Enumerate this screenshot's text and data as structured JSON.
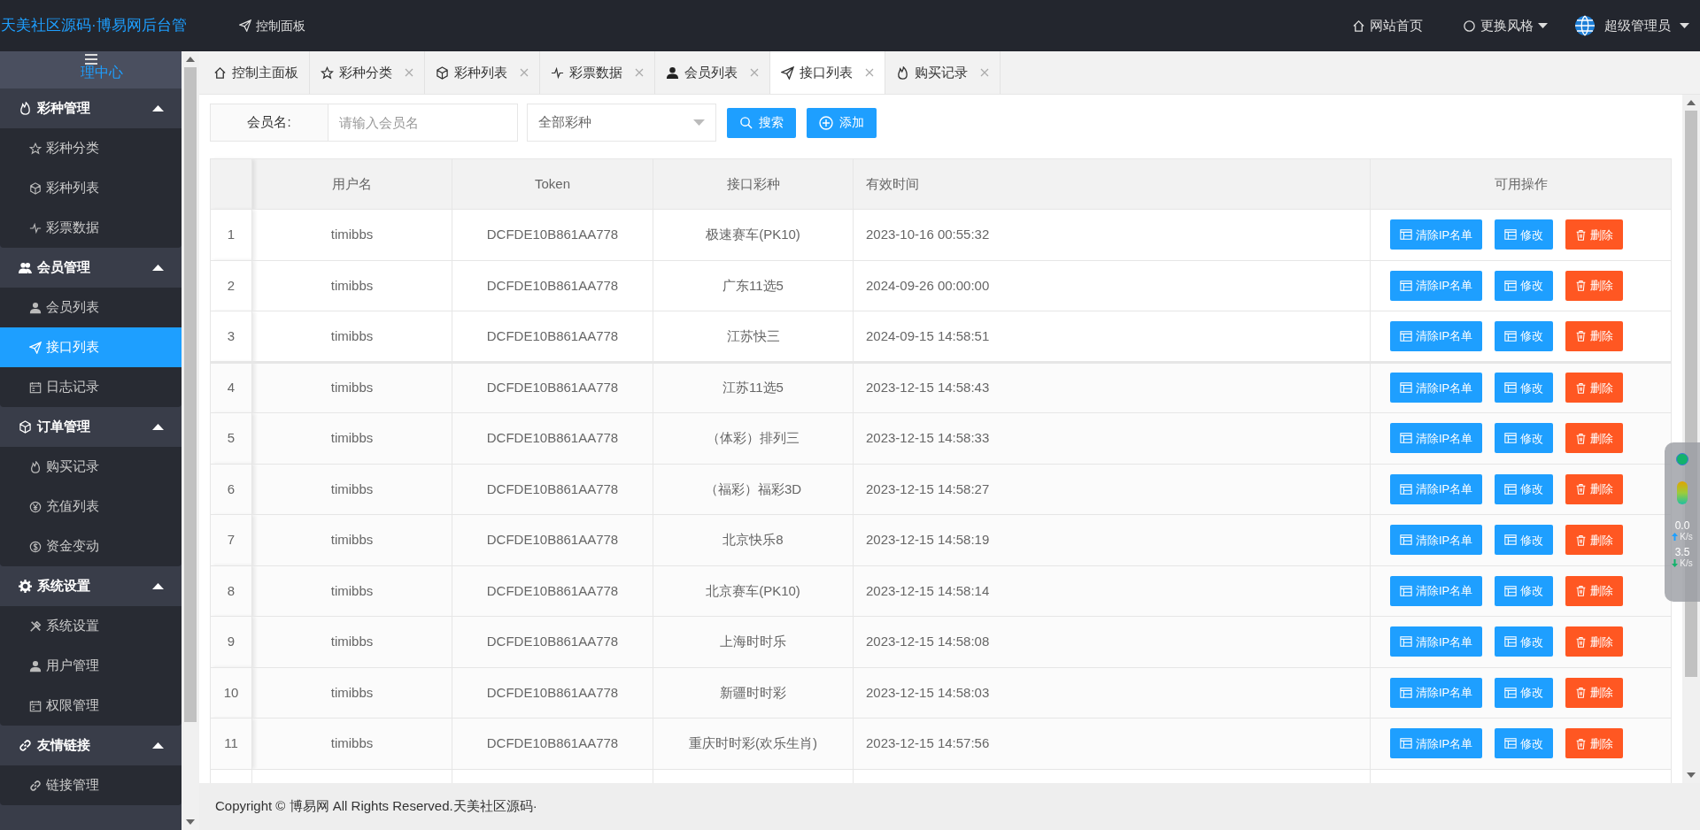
{
  "header": {
    "logo": "天美社区源码·博易网后台管",
    "nav_link": "控制面板",
    "right_links": [
      {
        "kind": "home",
        "label": "网站首页"
      },
      {
        "kind": "theme",
        "label": "更换风格"
      }
    ],
    "user": "超级管理员"
  },
  "sidebar": {
    "title": "理中心",
    "groups": [
      {
        "label": "彩种管理",
        "expanded": true,
        "items": [
          {
            "label": "彩种分类",
            "selected": false
          },
          {
            "label": "彩种列表",
            "selected": false
          },
          {
            "label": "彩票数据",
            "selected": false
          }
        ]
      },
      {
        "label": "会员管理",
        "expanded": true,
        "items": [
          {
            "label": "会员列表",
            "selected": false
          },
          {
            "label": "接口列表",
            "selected": true
          },
          {
            "label": "日志记录",
            "selected": false
          }
        ]
      },
      {
        "label": "订单管理",
        "expanded": true,
        "items": [
          {
            "label": "购买记录",
            "selected": false
          },
          {
            "label": "充值列表",
            "selected": false
          },
          {
            "label": "资金变动",
            "selected": false
          }
        ]
      },
      {
        "label": "系统设置",
        "expanded": true,
        "items": [
          {
            "label": "系统设置",
            "selected": false
          },
          {
            "label": "用户管理",
            "selected": false
          },
          {
            "label": "权限管理",
            "selected": false
          }
        ]
      },
      {
        "label": "友情链接",
        "expanded": true,
        "items": [
          {
            "label": "链接管理",
            "selected": false
          }
        ]
      }
    ]
  },
  "tabs": [
    {
      "label": "控制主面板",
      "closable": false,
      "selected": false
    },
    {
      "label": "彩种分类",
      "closable": true,
      "selected": false
    },
    {
      "label": "彩种列表",
      "closable": true,
      "selected": false
    },
    {
      "label": "彩票数据",
      "closable": true,
      "selected": false
    },
    {
      "label": "会员列表",
      "closable": true,
      "selected": false
    },
    {
      "label": "接口列表",
      "closable": true,
      "selected": true
    },
    {
      "label": "购买记录",
      "closable": true,
      "selected": false
    }
  ],
  "filter": {
    "label": "会员名:",
    "placeholder": "请输入会员名",
    "select": "全部彩种",
    "buttons": [
      {
        "kind": "search",
        "label": "搜索"
      },
      {
        "kind": "add",
        "label": "添加"
      }
    ]
  },
  "table": {
    "columns": [
      "用户名",
      "Token",
      "接口彩种",
      "有效时间",
      "可用操作"
    ],
    "rows": [
      {
        "index": "1",
        "username": "timibbs",
        "token": "DCFDE10B861AA778",
        "lottery": "极速赛车(PK10)",
        "expires": "2023-10-16 00:55:32",
        "actions": [
          {
            "kind": "clear",
            "label": "清除IP名单"
          },
          {
            "kind": "edit",
            "label": "修改"
          },
          {
            "kind": "delete",
            "label": "删除"
          }
        ]
      },
      {
        "index": "2",
        "username": "timibbs",
        "token": "DCFDE10B861AA778",
        "lottery": "广东11选5",
        "expires": "2024-09-26 00:00:00",
        "actions": [
          {
            "kind": "clear",
            "label": "清除IP名单"
          },
          {
            "kind": "edit",
            "label": "修改"
          },
          {
            "kind": "delete",
            "label": "删除"
          }
        ]
      },
      {
        "index": "3",
        "username": "timibbs",
        "token": "DCFDE10B861AA778",
        "lottery": "江苏快三",
        "expires": "2024-09-15 14:58:51",
        "actions": [
          {
            "kind": "clear",
            "label": "清除IP名单"
          },
          {
            "kind": "edit",
            "label": "修改"
          },
          {
            "kind": "delete",
            "label": "删除"
          }
        ]
      },
      {
        "index": "4",
        "username": "timibbs",
        "token": "DCFDE10B861AA778",
        "lottery": "江苏11选5",
        "expires": "2023-12-15 14:58:43",
        "actions": [
          {
            "kind": "clear",
            "label": "清除IP名单"
          },
          {
            "kind": "edit",
            "label": "修改"
          },
          {
            "kind": "delete",
            "label": "删除"
          }
        ]
      },
      {
        "index": "5",
        "username": "timibbs",
        "token": "DCFDE10B861AA778",
        "lottery": "（体彩）排列三",
        "expires": "2023-12-15 14:58:33",
        "actions": [
          {
            "kind": "clear",
            "label": "清除IP名单"
          },
          {
            "kind": "edit",
            "label": "修改"
          },
          {
            "kind": "delete",
            "label": "删除"
          }
        ]
      },
      {
        "index": "6",
        "username": "timibbs",
        "token": "DCFDE10B861AA778",
        "lottery": "（福彩）福彩3D",
        "expires": "2023-12-15 14:58:27",
        "actions": [
          {
            "kind": "clear",
            "label": "清除IP名单"
          },
          {
            "kind": "edit",
            "label": "修改"
          },
          {
            "kind": "delete",
            "label": "删除"
          }
        ]
      },
      {
        "index": "7",
        "username": "timibbs",
        "token": "DCFDE10B861AA778",
        "lottery": "北京快乐8",
        "expires": "2023-12-15 14:58:19",
        "actions": [
          {
            "kind": "clear",
            "label": "清除IP名单"
          },
          {
            "kind": "edit",
            "label": "修改"
          },
          {
            "kind": "delete",
            "label": "删除"
          }
        ]
      },
      {
        "index": "8",
        "username": "timibbs",
        "token": "DCFDE10B861AA778",
        "lottery": "北京赛车(PK10)",
        "expires": "2023-12-15 14:58:14",
        "actions": [
          {
            "kind": "clear",
            "label": "清除IP名单"
          },
          {
            "kind": "edit",
            "label": "修改"
          },
          {
            "kind": "delete",
            "label": "删除"
          }
        ]
      },
      {
        "index": "9",
        "username": "timibbs",
        "token": "DCFDE10B861AA778",
        "lottery": "上海时时乐",
        "expires": "2023-12-15 14:58:08",
        "actions": [
          {
            "kind": "clear",
            "label": "清除IP名单"
          },
          {
            "kind": "edit",
            "label": "修改"
          },
          {
            "kind": "delete",
            "label": "删除"
          }
        ]
      },
      {
        "index": "10",
        "username": "timibbs",
        "token": "DCFDE10B861AA778",
        "lottery": "新疆时时彩",
        "expires": "2023-12-15 14:58:03",
        "actions": [
          {
            "kind": "clear",
            "label": "清除IP名单"
          },
          {
            "kind": "edit",
            "label": "修改"
          },
          {
            "kind": "delete",
            "label": "删除"
          }
        ]
      },
      {
        "index": "11",
        "username": "timibbs",
        "token": "DCFDE10B861AA778",
        "lottery": "重庆时时彩(欢乐生肖)",
        "expires": "2023-12-15 14:57:56",
        "actions": [
          {
            "kind": "clear",
            "label": "清除IP名单"
          },
          {
            "kind": "edit",
            "label": "修改"
          },
          {
            "kind": "delete",
            "label": "删除"
          }
        ]
      }
    ]
  },
  "footer": "Copyright © 博易网 All Rights Reserved.天美社区源码·",
  "speed_widget": {
    "upload": "0.0",
    "upload_unit": "K/s",
    "download": "3.5",
    "download_unit": "K/s"
  }
}
